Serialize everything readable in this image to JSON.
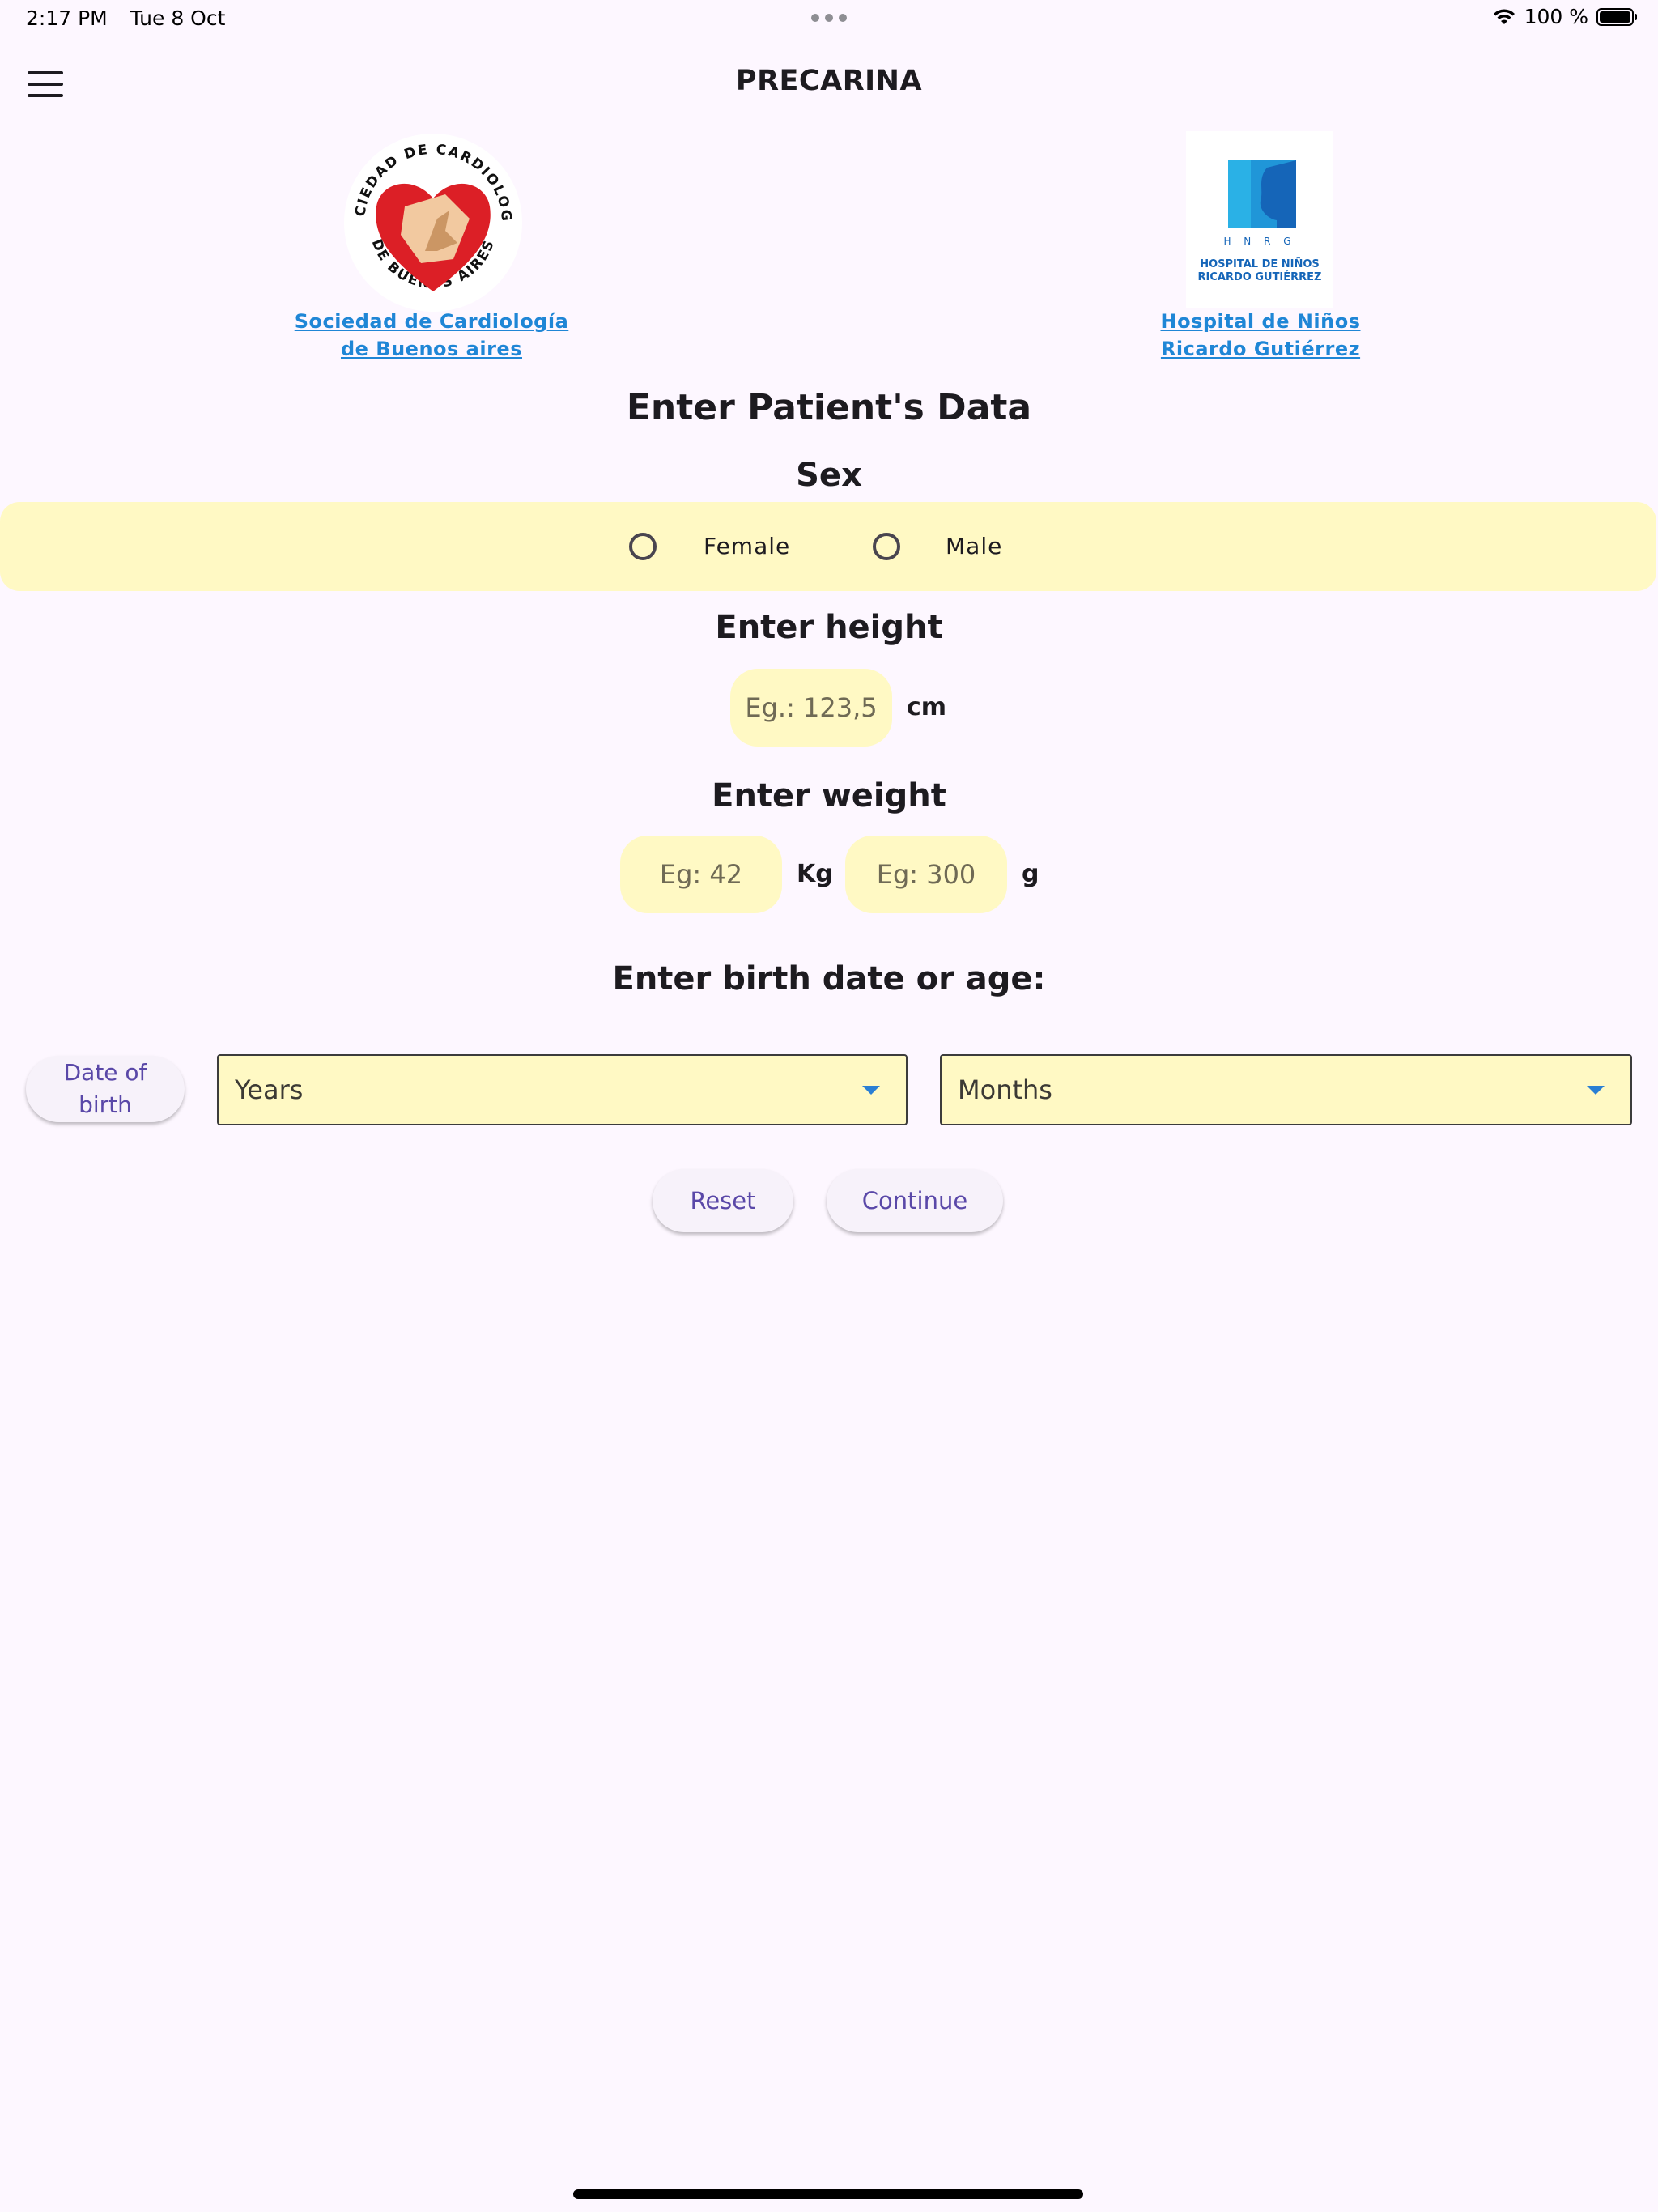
{
  "status_bar": {
    "time": "2:17 PM",
    "date": "Tue 8 Oct",
    "battery": "100 %",
    "icons": [
      "wifi-icon",
      "battery-icon",
      "multitasking-dots-icon"
    ]
  },
  "app_bar": {
    "title": "PRECARINA",
    "menu_icon": "hamburger-menu-icon"
  },
  "logos": {
    "left": {
      "link_line1": "Sociedad de Cardiología",
      "link_line2": "de Buenos aires",
      "seal_top": "SOCIEDAD DE CARDIOLOGIA",
      "seal_bottom": "DE BUENOS AIRES"
    },
    "right": {
      "link_line1": "Hospital de Niños",
      "link_line2": "Ricardo Gutiérrez",
      "mark_letters": "H N R G",
      "mark_line1": "HOSPITAL DE NIÑOS",
      "mark_line2": "RICARDO GUTIÉRREZ"
    }
  },
  "form": {
    "title": "Enter Patient's Data",
    "sex": {
      "heading": "Sex",
      "options": [
        {
          "label": "Female",
          "selected": false
        },
        {
          "label": "Male",
          "selected": false
        }
      ]
    },
    "height": {
      "heading": "Enter height",
      "placeholder": "Eg.: 123,5",
      "unit": "cm"
    },
    "weight": {
      "heading": "Enter weight",
      "kg_placeholder": "Eg: 42",
      "kg_unit": "Kg",
      "g_placeholder": "Eg: 300",
      "g_unit": "g"
    },
    "birth": {
      "heading": "Enter birth date or age:",
      "date_button_line1": "Date of",
      "date_button_line2": "birth",
      "years_label": "Years",
      "months_label": "Months"
    },
    "actions": {
      "reset": "Reset",
      "continue": "Continue"
    }
  },
  "colors": {
    "background": "#fdf7ff",
    "field_fill": "#fff9c4",
    "link": "#1f86d6",
    "button_text": "#5a48a8",
    "dropdown_caret": "#2a7fd4"
  }
}
